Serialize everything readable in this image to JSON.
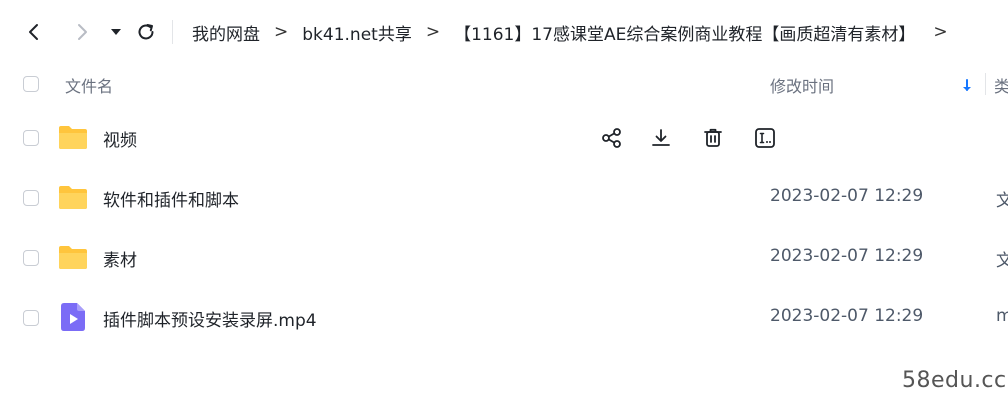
{
  "breadcrumb": {
    "items": [
      "我的网盘",
      "bk41.net共享",
      "【1161】17感课堂AE综合案例商业教程【画质超清有素材】"
    ],
    "separator": ">"
  },
  "columns": {
    "name": "文件名",
    "modified": "修改时间",
    "type": "类"
  },
  "files": [
    {
      "name": "视频",
      "date": "",
      "type": "",
      "icon": "folder-icon"
    },
    {
      "name": "软件和插件和脚本",
      "date": "2023-02-07 12:29",
      "type": "文",
      "icon": "folder-icon"
    },
    {
      "name": "素材",
      "date": "2023-02-07 12:29",
      "type": "文",
      "icon": "folder-icon"
    },
    {
      "name": "插件脚本预设安装录屏.mp4",
      "date": "2023-02-07 12:29",
      "type": "m",
      "icon": "video-file-icon"
    }
  ],
  "icons": {
    "back": "chevron-left-icon",
    "forward": "chevron-right-icon",
    "history": "caret-down-icon",
    "refresh": "refresh-icon",
    "share": "share-icon",
    "download": "download-icon",
    "delete": "trash-icon",
    "rename": "rename-icon",
    "sort": "sort-down-icon"
  },
  "colors": {
    "folder": "#ffc53d",
    "video": "#7b6cf6",
    "accent": "#1677ff"
  },
  "watermark": "58edu.cc"
}
